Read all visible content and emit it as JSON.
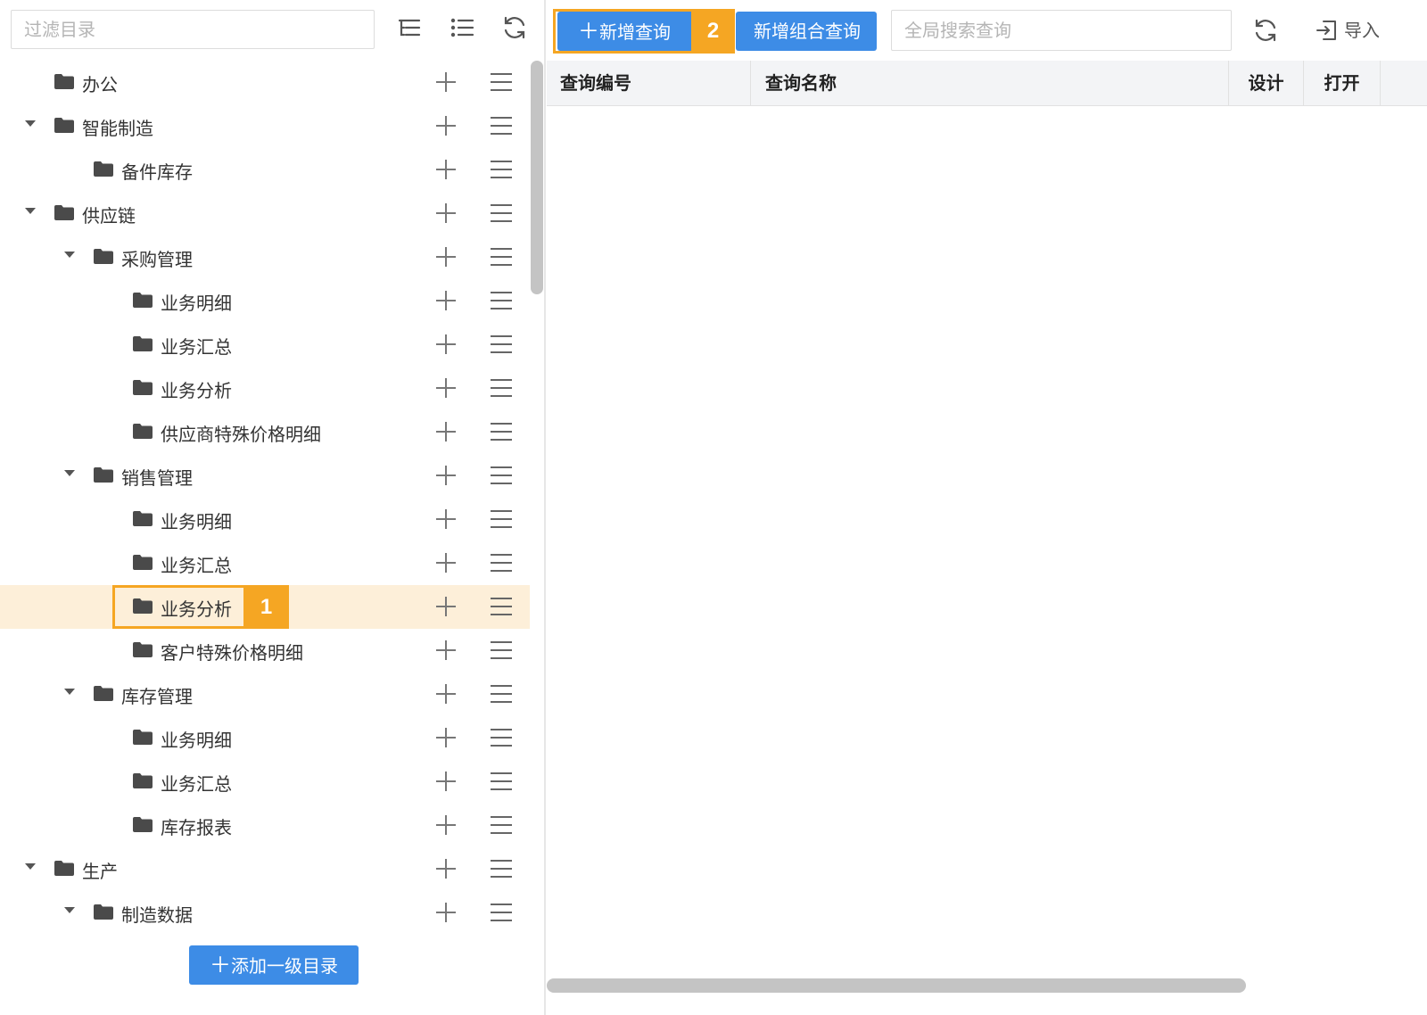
{
  "sidebar": {
    "filter_placeholder": "过滤目录",
    "toolbar_icons": [
      "expand-tree-icon",
      "list-icon",
      "refresh-icon"
    ],
    "tree": [
      {
        "label": "办公",
        "level": 0,
        "expandable": false,
        "selected": false
      },
      {
        "label": "智能制造",
        "level": 0,
        "expandable": true,
        "selected": false
      },
      {
        "label": "备件库存",
        "level": 1,
        "expandable": false,
        "selected": false
      },
      {
        "label": "供应链",
        "level": 0,
        "expandable": true,
        "selected": false
      },
      {
        "label": "采购管理",
        "level": 1,
        "expandable": true,
        "selected": false
      },
      {
        "label": "业务明细",
        "level": 2,
        "expandable": false,
        "selected": false
      },
      {
        "label": "业务汇总",
        "level": 2,
        "expandable": false,
        "selected": false
      },
      {
        "label": "业务分析",
        "level": 2,
        "expandable": false,
        "selected": false
      },
      {
        "label": "供应商特殊价格明细",
        "level": 2,
        "expandable": false,
        "selected": false
      },
      {
        "label": "销售管理",
        "level": 1,
        "expandable": true,
        "selected": false
      },
      {
        "label": "业务明细",
        "level": 2,
        "expandable": false,
        "selected": false
      },
      {
        "label": "业务汇总",
        "level": 2,
        "expandable": false,
        "selected": false
      },
      {
        "label": "业务分析",
        "level": 2,
        "expandable": false,
        "selected": true
      },
      {
        "label": "客户特殊价格明细",
        "level": 2,
        "expandable": false,
        "selected": false
      },
      {
        "label": "库存管理",
        "level": 1,
        "expandable": true,
        "selected": false
      },
      {
        "label": "业务明细",
        "level": 2,
        "expandable": false,
        "selected": false
      },
      {
        "label": "业务汇总",
        "level": 2,
        "expandable": false,
        "selected": false
      },
      {
        "label": "库存报表",
        "level": 2,
        "expandable": false,
        "selected": false
      },
      {
        "label": "生产",
        "level": 0,
        "expandable": true,
        "selected": false
      },
      {
        "label": "制造数据",
        "level": 1,
        "expandable": true,
        "selected": false
      }
    ],
    "add_root_label": "添加一级目录"
  },
  "toolbar": {
    "new_query_label": "新增查询",
    "new_combo_query_label": "新增组合查询",
    "search_placeholder": "全局搜索查询",
    "import_label": "导入"
  },
  "table": {
    "columns": [
      "查询编号",
      "查询名称",
      "设计",
      "打开"
    ]
  },
  "annotations": [
    {
      "number": "1",
      "target": "业务分析"
    },
    {
      "number": "2",
      "target": "新增查询"
    }
  ],
  "colors": {
    "primary": "#3d8ce6",
    "highlight": "#f5a623",
    "selected_row": "#fdefd9"
  }
}
